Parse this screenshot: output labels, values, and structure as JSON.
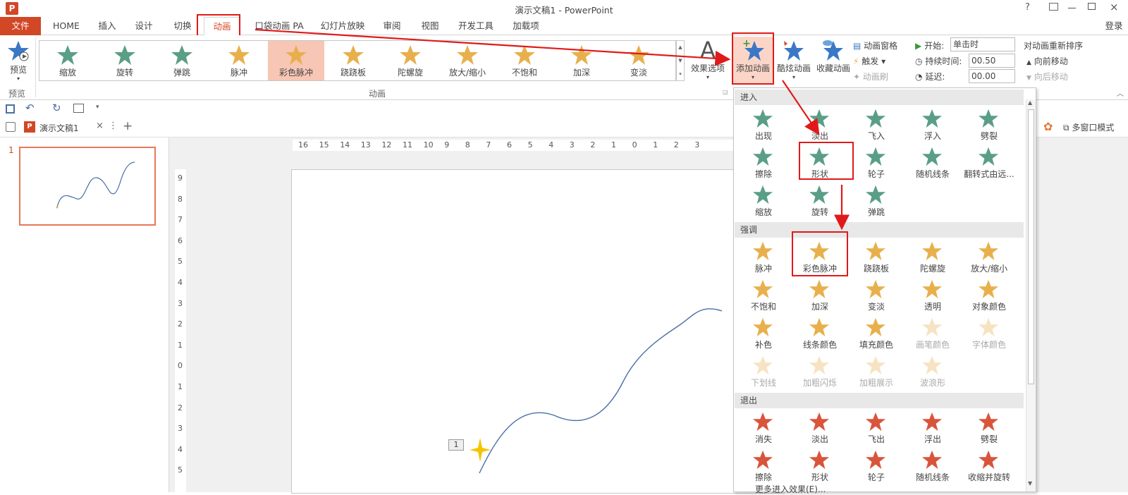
{
  "window": {
    "title": "演示文稿1 - PowerPoint",
    "app_icon_letter": "P",
    "login": "登录"
  },
  "tabs": [
    "文件",
    "HOME",
    "插入",
    "设计",
    "切换",
    "动画",
    "口袋动画 PA",
    "幻灯片放映",
    "审阅",
    "视图",
    "开发工具",
    "加载项"
  ],
  "ribbon": {
    "preview": {
      "label": "预览",
      "group": "预览"
    },
    "gallery": [
      "缩放",
      "旋转",
      "弹跳",
      "脉冲",
      "彩色脉冲",
      "跷跷板",
      "陀螺旋",
      "放大/缩小",
      "不饱和",
      "加深",
      "变淡"
    ],
    "gallery_selected": "彩色脉冲",
    "animation_group": "动画",
    "effect_options": "效果选项",
    "add_animation": "添加动画",
    "cool_animation": "酷炫动画",
    "fav_animation": "收藏动画",
    "anim_pane": "动画窗格",
    "trigger": "触发",
    "anim_brush": "动画刷",
    "start_label": "开始:",
    "start_value": "单击时",
    "duration_label": "持续时间:",
    "duration_value": "00.50",
    "delay_label": "延迟:",
    "delay_value": "00.00",
    "reorder_title": "对动画重新排序",
    "move_earlier": "向前移动",
    "move_later": "向后移动"
  },
  "doc_tab": {
    "name": "演示文稿1",
    "multiwindow": "多窗口模式"
  },
  "slide_panel": {
    "number": "1"
  },
  "rulers": {
    "h": [
      "16",
      "15",
      "14",
      "13",
      "12",
      "11",
      "10",
      "9",
      "8",
      "7",
      "6",
      "5",
      "4",
      "3",
      "2",
      "1",
      "0",
      "1",
      "2",
      "3"
    ],
    "v": [
      "9",
      "8",
      "7",
      "6",
      "5",
      "4",
      "3",
      "2",
      "1",
      "0",
      "1",
      "2",
      "3",
      "4",
      "5"
    ]
  },
  "slide": {
    "anim_tag": "1"
  },
  "dropdown": {
    "sections": {
      "enter": "进入",
      "emphasis": "强调",
      "exit": "退出"
    },
    "enter": [
      "出现",
      "淡出",
      "飞入",
      "浮入",
      "劈裂",
      "擦除",
      "形状",
      "轮子",
      "随机线条",
      "翻转式由远...",
      "缩放",
      "旋转",
      "弹跳"
    ],
    "emphasis": [
      "脉冲",
      "彩色脉冲",
      "跷跷板",
      "陀螺旋",
      "放大/缩小",
      "不饱和",
      "加深",
      "变淡",
      "透明",
      "对象颜色",
      "补色",
      "线条颜色",
      "填充颜色",
      "画笔颜色",
      "字体颜色",
      "下划线",
      "加粗闪烁",
      "加粗展示",
      "波浪形"
    ],
    "exit": [
      "消失",
      "淡出",
      "飞出",
      "浮出",
      "劈裂",
      "擦除",
      "形状",
      "轮子",
      "随机线条",
      "收缩并旋转"
    ],
    "more": "更多进入效果(E)..."
  },
  "colors": {
    "accent": "#d24726",
    "enter_star": "#5a9e86",
    "emph_star": "#e8b04c",
    "exit_star": "#d9543b",
    "blue_star": "#3a78c6",
    "highlight": "#e01a1a"
  }
}
